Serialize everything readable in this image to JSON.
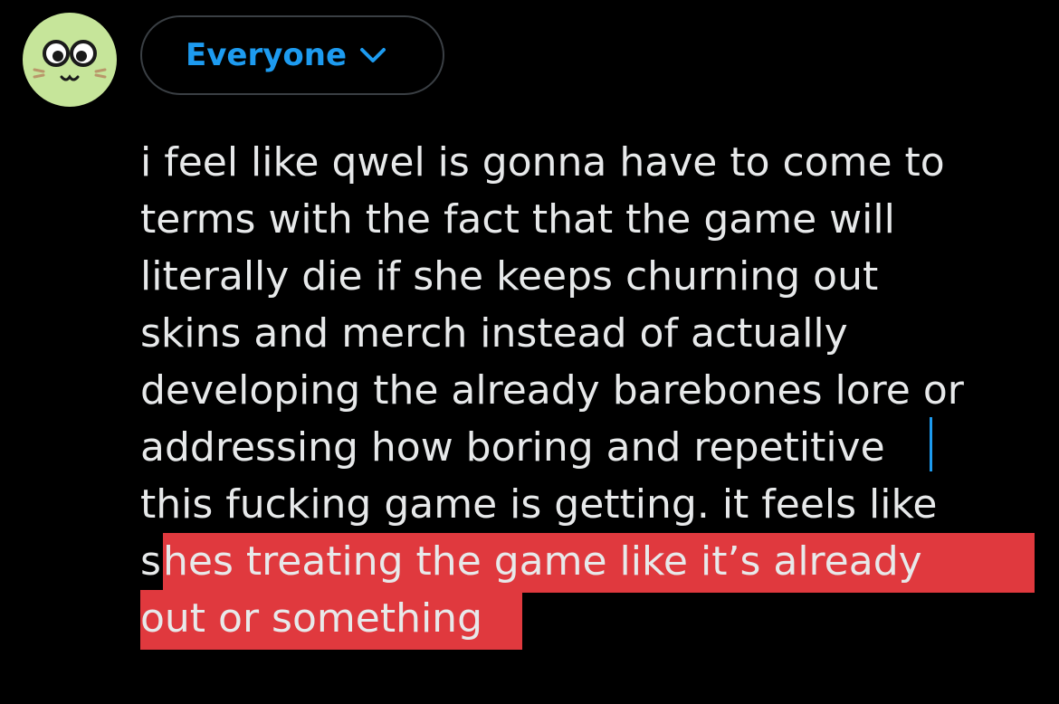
{
  "audience": {
    "label": "Everyone",
    "accent_color": "#1d9bf0"
  },
  "avatar": {
    "icon": "cartoon-cat-face-icon",
    "color": "#c6e59a"
  },
  "composer": {
    "lines": [
      "i feel like qwel is gonna have to come to",
      "terms with the fact that the game will",
      "literally die if she keeps churning out",
      "skins and merch instead of actually",
      "developing the already barebones lore or",
      "addressing how boring and repetitive",
      "this fucking game is getting. it feels like",
      "s",
      "hes treating the game like it’s already",
      "out or something"
    ],
    "over_limit_highlight_color": "#e0393e",
    "caret_color": "#1d9bf0"
  }
}
